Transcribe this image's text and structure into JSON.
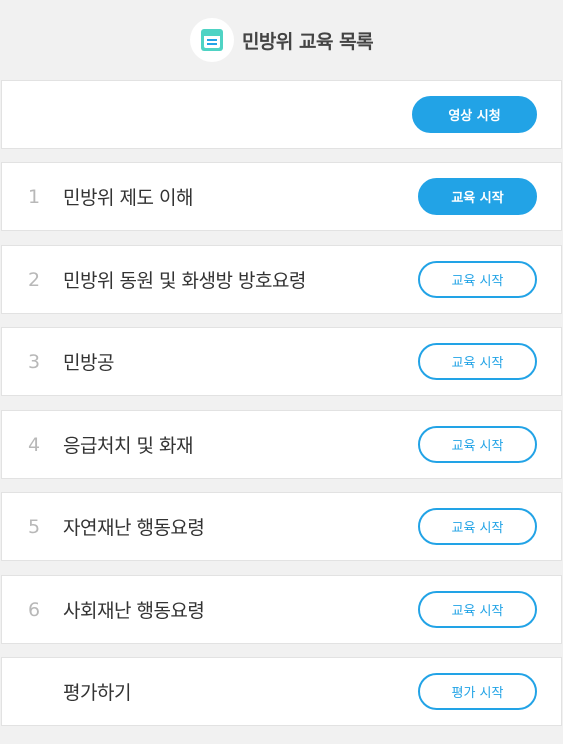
{
  "header": {
    "title": "민방위 교육 목록",
    "icon": "list-document-icon"
  },
  "video": {
    "button_label": "영상 시청"
  },
  "lessons": [
    {
      "number": "1",
      "title": "민방위 제도 이해",
      "button_label": "교육 시작",
      "active": true
    },
    {
      "number": "2",
      "title": "민방위 동원 및 화생방 방호요령",
      "button_label": "교육 시작",
      "active": false
    },
    {
      "number": "3",
      "title": "민방공",
      "button_label": "교육 시작",
      "active": false
    },
    {
      "number": "4",
      "title": "응급처치 및 화재",
      "button_label": "교육 시작",
      "active": false
    },
    {
      "number": "5",
      "title": "자연재난 행동요령",
      "button_label": "교육 시작",
      "active": false
    },
    {
      "number": "6",
      "title": "사회재난 행동요령",
      "button_label": "교육 시작",
      "active": false
    }
  ],
  "evaluation": {
    "title": "평가하기",
    "button_label": "평가 시작"
  },
  "colors": {
    "accent": "#22a3e6",
    "background": "#f1f1f1"
  }
}
